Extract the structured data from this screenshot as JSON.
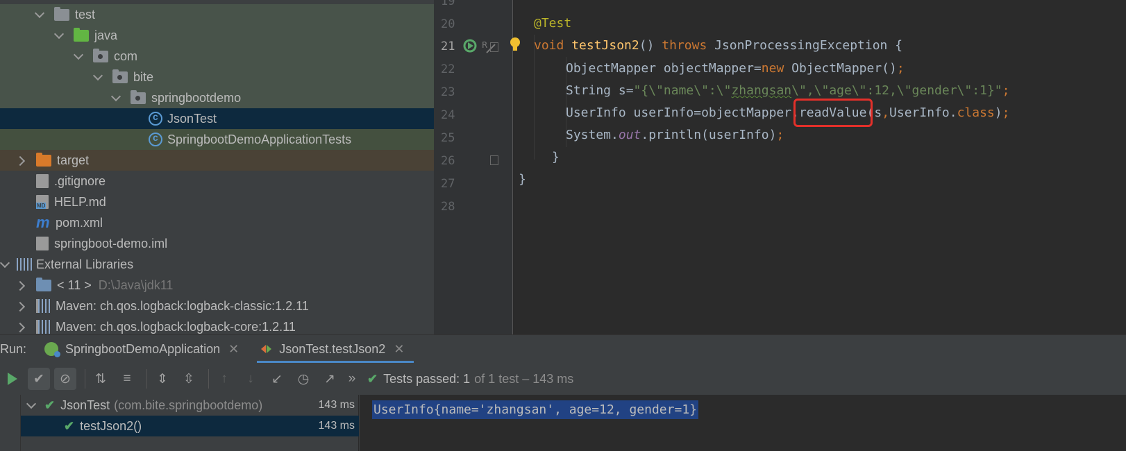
{
  "tree": {
    "items": [
      {
        "label": "test"
      },
      {
        "label": "java"
      },
      {
        "label": "com"
      },
      {
        "label": "bite"
      },
      {
        "label": "springbootdemo"
      },
      {
        "label": "JsonTest"
      },
      {
        "label": "SpringbootDemoApplicationTests"
      },
      {
        "label": "target"
      },
      {
        "label": ".gitignore"
      },
      {
        "label": "HELP.md"
      },
      {
        "label": "pom.xml"
      },
      {
        "label": "springboot-demo.iml"
      },
      {
        "label": "External Libraries"
      },
      {
        "label": "< 11 >",
        "hint": "D:\\Java\\jdk11"
      },
      {
        "label": "Maven: ch.qos.logback:logback-classic:1.2.11"
      },
      {
        "label": "Maven: ch.qos.logback:logback-core:1.2.11"
      }
    ]
  },
  "editor": {
    "line_numbers": [
      "19",
      "20",
      "21",
      "22",
      "23",
      "24",
      "25",
      "26",
      "27",
      "28"
    ],
    "lines": {
      "l20": {
        "annotation": "@Test"
      },
      "l21": {
        "void": "void",
        "method": "testJson2",
        "paren": "() ",
        "throws": "throws",
        "rest": " JsonProcessingException {"
      },
      "l22": {
        "a": "ObjectMapper objectMapper=",
        "new": "new",
        "b": " ObjectMapper()",
        "semi": ";"
      },
      "l23": {
        "a": "String s=",
        "str1": "\"{\\\"name\\\":\\\"",
        "wavy": "zhangsan",
        "str2": "\\\",\\\"age\\\":12,\\\"gender\\\":1}\"",
        "semi": ";"
      },
      "l24": {
        "a": "UserInfo userInfo=objectMapper.",
        "method": "readValue",
        "b": "(s",
        "comma": ",",
        "c": "UserInfo.",
        "cls": "class",
        "d": ")",
        "semi": ";"
      },
      "l25": {
        "a": "System.",
        "out": "out",
        "b": ".println(userInfo)",
        "semi": ";"
      },
      "l26": {
        "brace": "}"
      },
      "l27": {
        "brace": "}"
      }
    },
    "highlighted_token": "readValue"
  },
  "run": {
    "label": "Run:",
    "tabs": [
      {
        "label": "SpringbootDemoApplication",
        "active": false
      },
      {
        "label": "JsonTest.testJson2",
        "active": true
      }
    ],
    "status": {
      "prefix": "Tests passed:",
      "count": "1",
      "suffix": "of 1 test – 143 ms"
    },
    "results": [
      {
        "label": "JsonTest",
        "pkg": "(com.bite.springbootdemo)",
        "time": "143 ms"
      },
      {
        "label": "testJson2()",
        "time": "143 ms"
      }
    ],
    "console_output": "UserInfo{name='zhangsan', age=12, gender=1}"
  },
  "colors": {
    "keyword": "#cc7832",
    "annotation": "#bbb529",
    "string": "#6a8759",
    "method": "#ffc66d",
    "highlight_box": "#e3302a",
    "pass_green": "#59a869"
  }
}
